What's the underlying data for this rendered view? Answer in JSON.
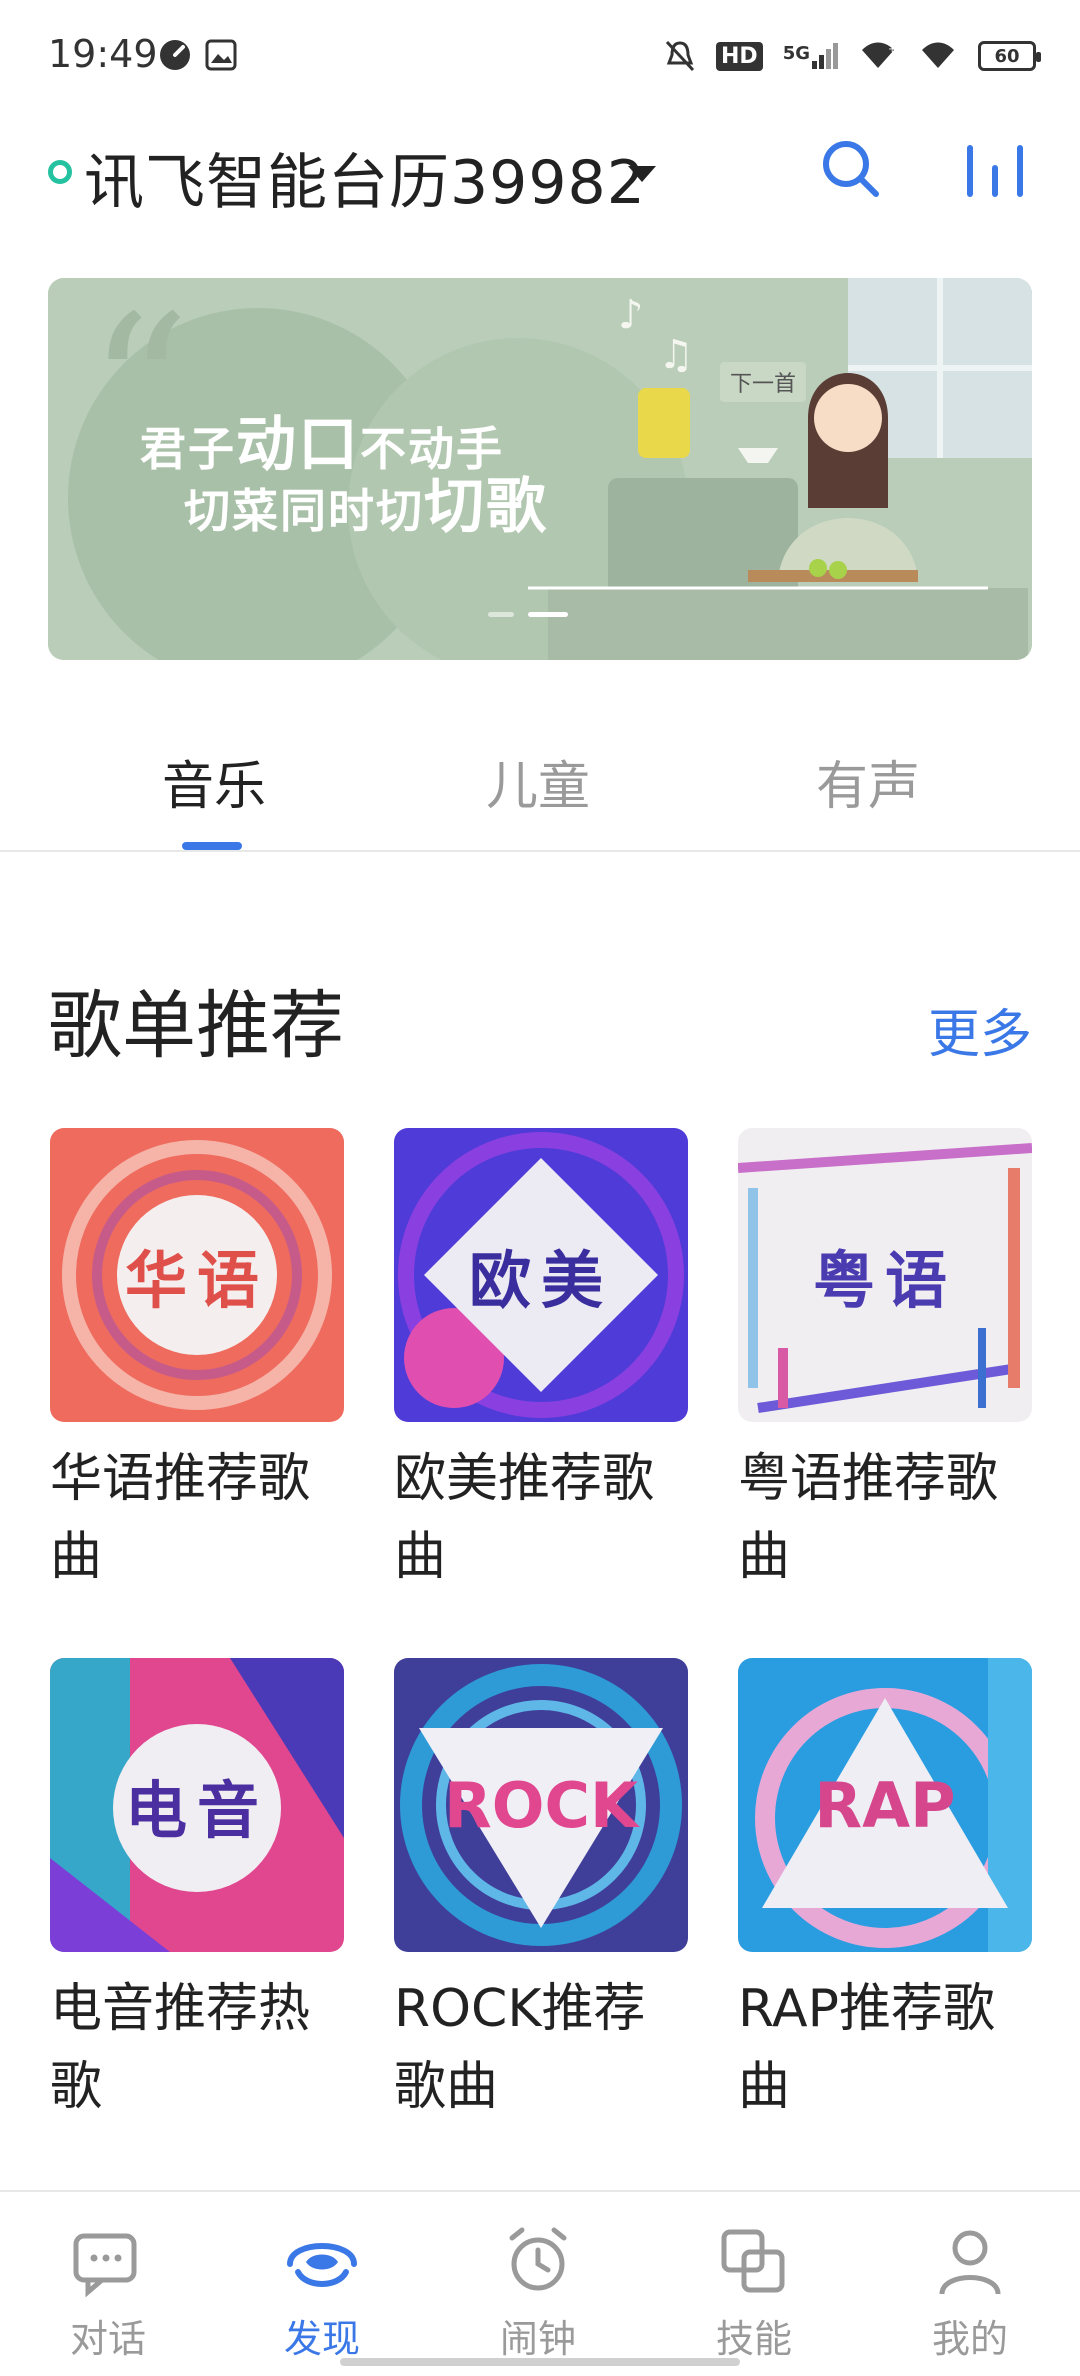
{
  "status_bar": {
    "time": "19:49",
    "network": "5G",
    "hd": "HD",
    "battery": "60"
  },
  "header": {
    "device_name": "讯飞智能台历39982"
  },
  "banner": {
    "line1_a": "君子",
    "line1_b": "动口",
    "line1_c": "不动手",
    "line2_a": "切菜同时切",
    "line2_b": "切歌",
    "next_label": "下一首"
  },
  "tabs": [
    {
      "label": "音乐",
      "active": true
    },
    {
      "label": "儿童",
      "active": false
    },
    {
      "label": "有声",
      "active": false
    }
  ],
  "section": {
    "title": "歌单推荐",
    "more": "更多"
  },
  "playlists": [
    {
      "cover_text": "华语",
      "title": "华语推荐歌曲"
    },
    {
      "cover_text": "欧美",
      "title": "欧美推荐歌曲"
    },
    {
      "cover_text": "粤语",
      "title": "粤语推荐歌曲"
    },
    {
      "cover_text": "电音",
      "title": "电音推荐热歌"
    },
    {
      "cover_text": "ROCK",
      "title": "ROCK推荐歌曲"
    },
    {
      "cover_text": "RAP",
      "title": "RAP推荐歌曲"
    }
  ],
  "bottom_nav": [
    {
      "label": "对话",
      "icon": "chat-icon",
      "active": false
    },
    {
      "label": "发现",
      "icon": "discover-icon",
      "active": true
    },
    {
      "label": "闹钟",
      "icon": "alarm-icon",
      "active": false
    },
    {
      "label": "技能",
      "icon": "skills-icon",
      "active": false
    },
    {
      "label": "我的",
      "icon": "profile-icon",
      "active": false
    }
  ],
  "colors": {
    "accent": "#3b78e7",
    "online": "#24c2a0",
    "banner_bg": "#b9cdb8"
  }
}
